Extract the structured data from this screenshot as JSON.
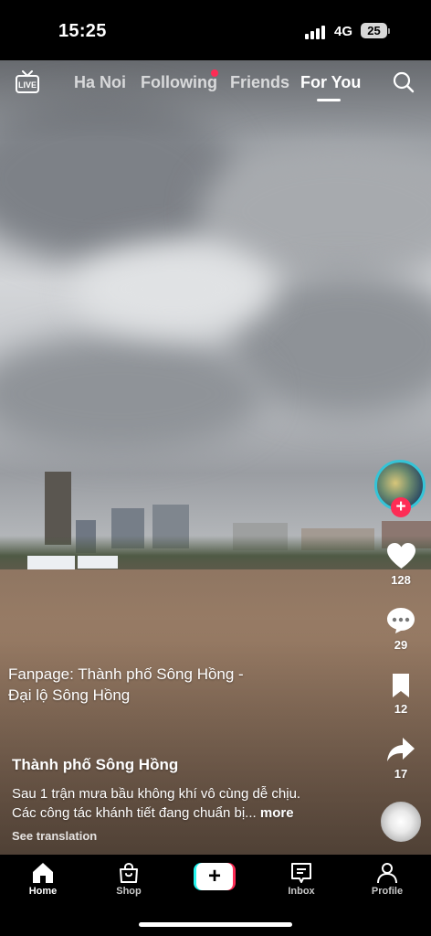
{
  "status_bar": {
    "time": "15:25",
    "network": "4G",
    "battery": "25"
  },
  "top_nav": {
    "live_label": "LIVE",
    "tabs": [
      {
        "label": "Ha Noi",
        "active": false
      },
      {
        "label": "Following",
        "active": false,
        "has_dot": true
      },
      {
        "label": "Friends",
        "active": false
      },
      {
        "label": "For You",
        "active": true
      }
    ],
    "search_icon": "search-icon"
  },
  "sidebar": {
    "likes": "128",
    "comments": "29",
    "saves": "12",
    "shares": "17"
  },
  "video_overlay_text": "Fanpage: Thành phố Sông Hồng - Đại lộ Sông Hồng",
  "post": {
    "author": "Thành phố Sông Hồng",
    "caption_line1": "Sau 1 trận mưa bầu không khí vô cùng dễ chịu.",
    "caption_line2": "Các công tác khánh tiết đang chuẩn bị...",
    "more": "more",
    "see_translation": "See translation"
  },
  "bottom_nav": {
    "items": [
      {
        "label": "Home",
        "icon": "home-icon",
        "active": true
      },
      {
        "label": "Shop",
        "icon": "shop-icon",
        "active": false
      },
      {
        "label": "Inbox",
        "icon": "inbox-icon",
        "active": false
      },
      {
        "label": "Profile",
        "icon": "profile-icon",
        "active": false
      }
    ],
    "create_icon": "plus-icon"
  },
  "colors": {
    "accent": "#fe2c55",
    "cyan": "#25f4ee",
    "avatar_ring": "#35c4d7"
  }
}
